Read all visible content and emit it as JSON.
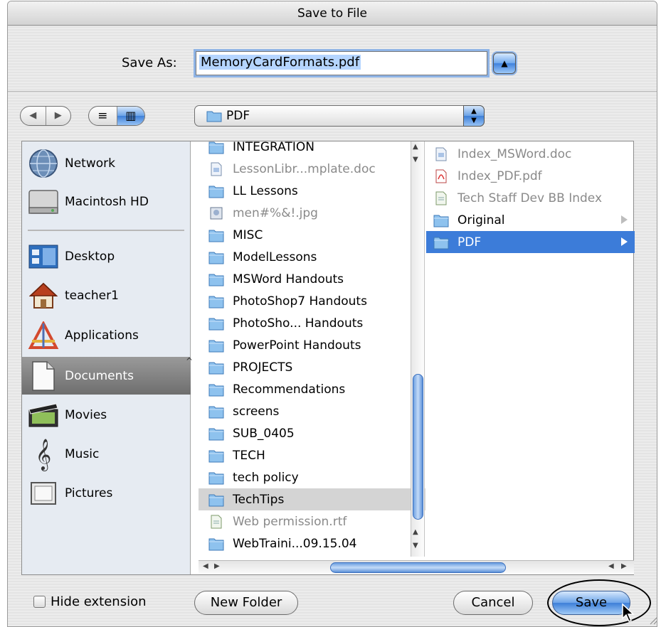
{
  "window": {
    "title": "Save to File"
  },
  "save_as": {
    "label": "Save As:",
    "value": "MemoryCardFormats.pdf"
  },
  "toolbar": {
    "back": "◀",
    "forward": "▶",
    "list_view": "≡",
    "column_view": "▥"
  },
  "path_popup": {
    "selected": "PDF"
  },
  "sidebar": {
    "devices": [
      {
        "label": "Network",
        "icon": "network-icon"
      },
      {
        "label": "Macintosh HD",
        "icon": "hard-drive-icon"
      }
    ],
    "places": [
      {
        "label": "Desktop",
        "icon": "desktop-icon"
      },
      {
        "label": "teacher1",
        "icon": "home-icon"
      },
      {
        "label": "Applications",
        "icon": "applications-icon"
      },
      {
        "label": "Documents",
        "icon": "documents-icon",
        "selected": true
      },
      {
        "label": "Movies",
        "icon": "movies-icon"
      },
      {
        "label": "Music",
        "icon": "music-icon"
      },
      {
        "label": "Pictures",
        "icon": "pictures-icon"
      }
    ]
  },
  "column1": [
    {
      "name": "INTEGRATION",
      "kind": "folder"
    },
    {
      "name": "LessonLibr...mplate.doc",
      "kind": "doc"
    },
    {
      "name": "LL Lessons",
      "kind": "folder"
    },
    {
      "name": "men#%&!.jpg",
      "kind": "image"
    },
    {
      "name": "MISC",
      "kind": "folder"
    },
    {
      "name": "ModelLessons",
      "kind": "folder"
    },
    {
      "name": "MSWord Handouts",
      "kind": "folder"
    },
    {
      "name": "PhotoShop7 Handouts",
      "kind": "folder"
    },
    {
      "name": "PhotoSho... Handouts",
      "kind": "folder"
    },
    {
      "name": "PowerPoint Handouts",
      "kind": "folder"
    },
    {
      "name": "PROJECTS",
      "kind": "folder"
    },
    {
      "name": "Recommendations",
      "kind": "folder"
    },
    {
      "name": "screens",
      "kind": "folder"
    },
    {
      "name": "SUB_0405",
      "kind": "folder"
    },
    {
      "name": "TECH",
      "kind": "folder"
    },
    {
      "name": "tech policy",
      "kind": "folder"
    },
    {
      "name": "TechTips",
      "kind": "folder",
      "highlighted": true
    },
    {
      "name": "Web permission.rtf",
      "kind": "rtf"
    },
    {
      "name": "WebTraini...09.15.04",
      "kind": "folder"
    }
  ],
  "column2": [
    {
      "name": "Index_MSWord.doc",
      "kind": "doc"
    },
    {
      "name": "Index_PDF.pdf",
      "kind": "pdf"
    },
    {
      "name": "Tech Staff Dev BB Index",
      "kind": "rtf"
    },
    {
      "name": "Original",
      "kind": "folder"
    },
    {
      "name": "PDF",
      "kind": "folder",
      "selected": true
    }
  ],
  "footer": {
    "hide_extension": "Hide extension",
    "new_folder": "New Folder",
    "cancel": "Cancel",
    "save": "Save"
  }
}
